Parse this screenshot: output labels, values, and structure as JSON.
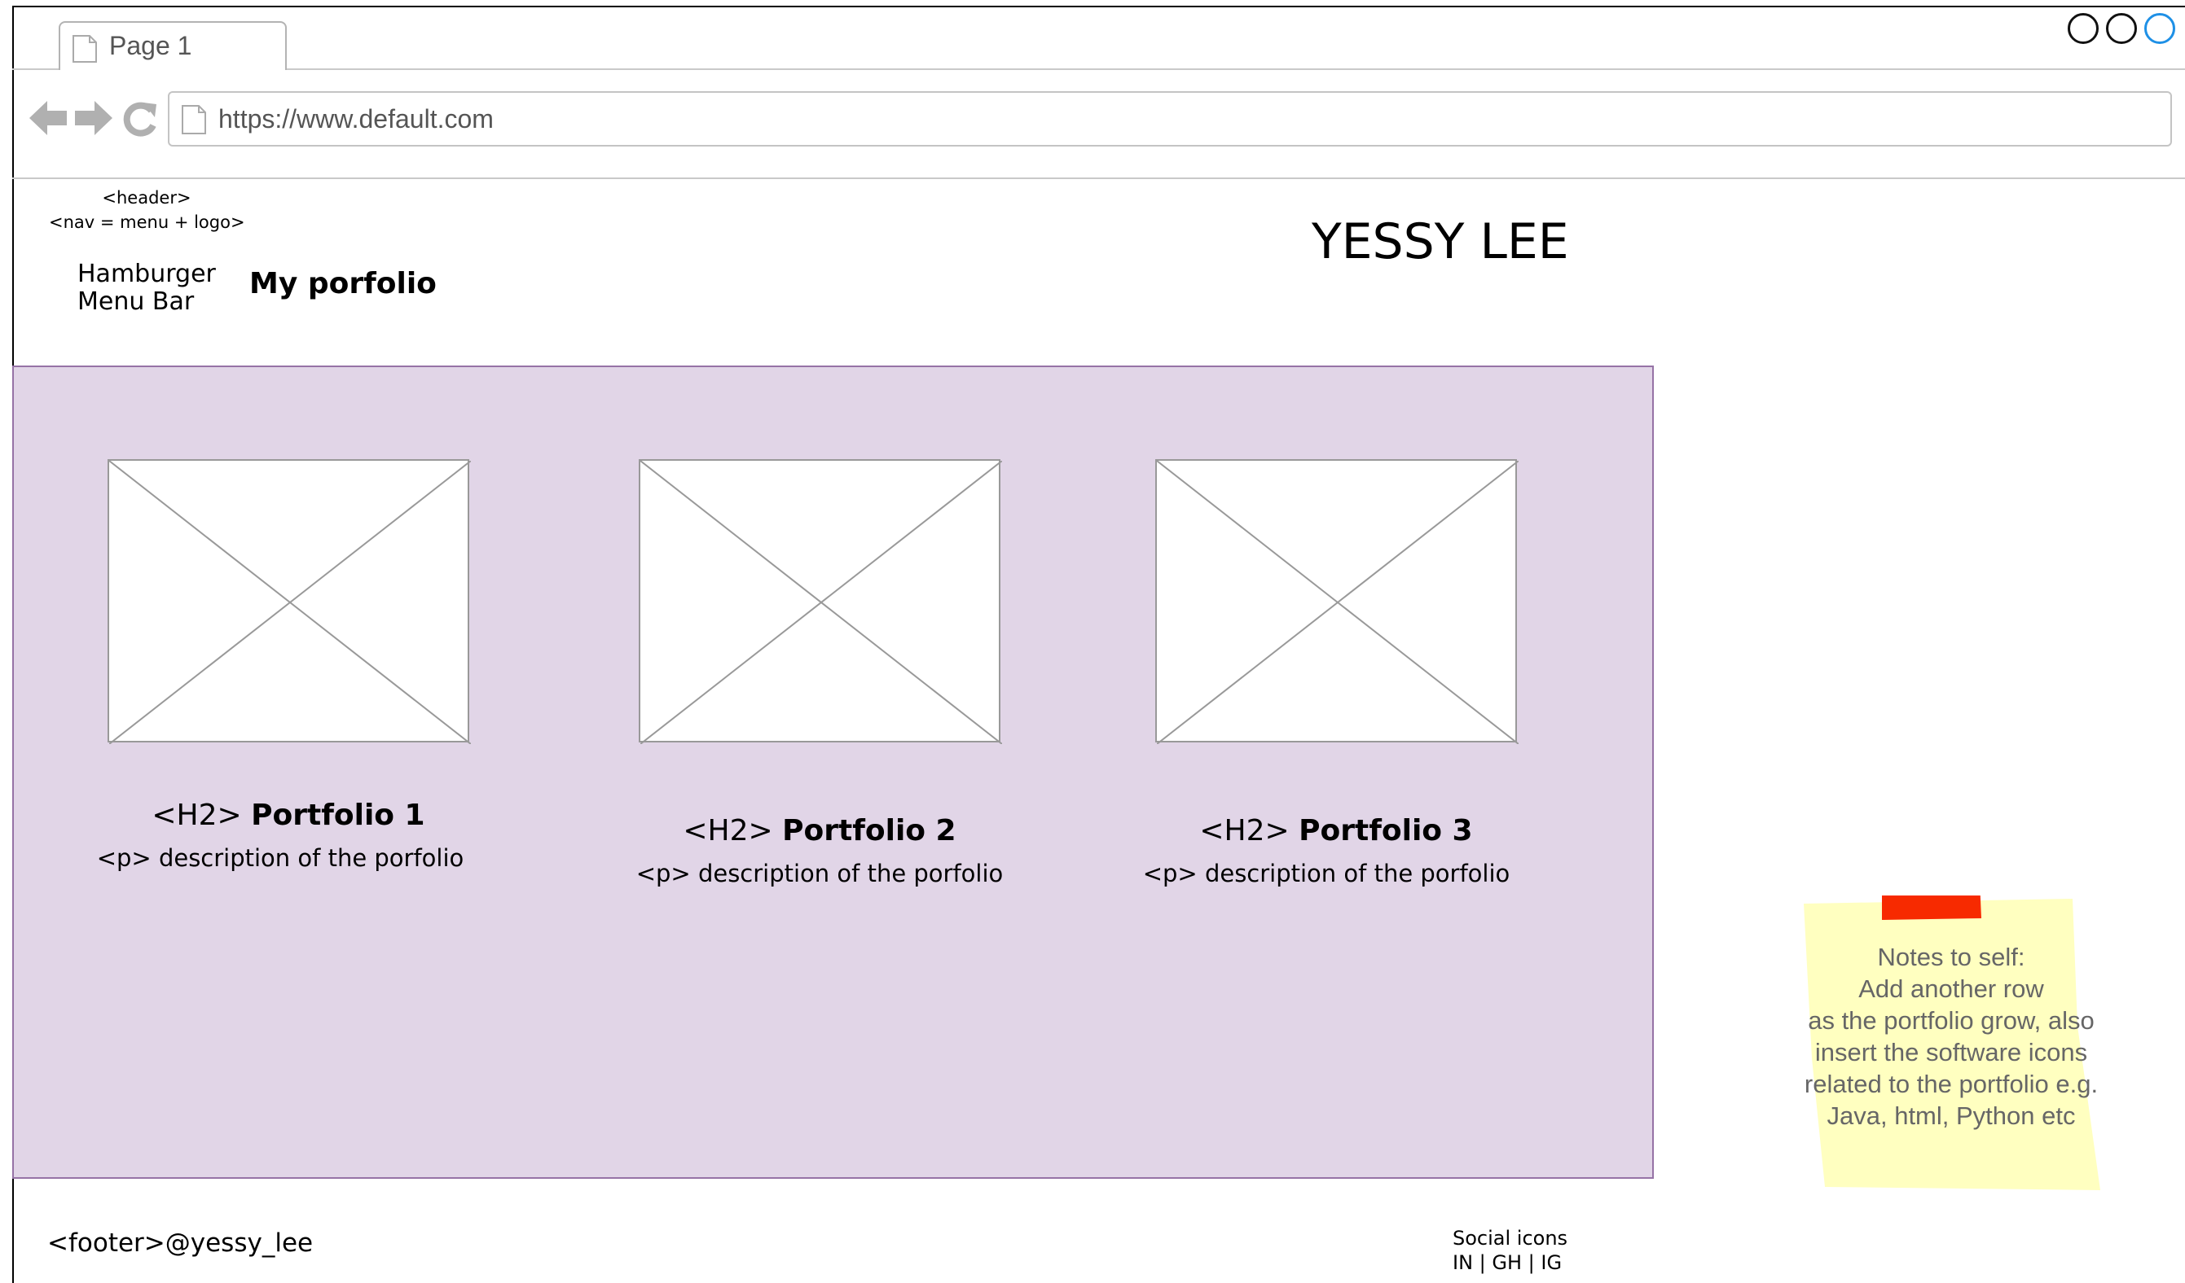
{
  "browser": {
    "tab_label": "Page 1",
    "url": "https://www.default.com",
    "icons": [
      "page-icon",
      "back-arrow-icon",
      "forward-arrow-icon",
      "reload-icon"
    ]
  },
  "header": {
    "note_line1": "<header>",
    "note_line2": "<nav = menu + logo>",
    "hamburger_line1": "Hamburger",
    "hamburger_line2": "Menu Bar",
    "logo": "My porfolio",
    "site_title": "YESSY LEE"
  },
  "portfolios": [
    {
      "tag": "<H2>",
      "title": "Portfolio 1",
      "desc": "<p> description of the porfolio"
    },
    {
      "tag": "<H2>",
      "title": "Portfolio 2",
      "desc": "<p> description of the porfolio"
    },
    {
      "tag": "<H2>",
      "title": "Portfolio 3",
      "desc": "<p> description of the porfolio"
    }
  ],
  "footer": {
    "left": "<footer>@yessy_lee",
    "social_title": "Social icons",
    "social_links": "IN | GH | IG"
  },
  "sticky_note": {
    "lines": [
      "Notes to self:",
      "Add another row",
      "as the portfolio grow, also",
      "insert the software icons",
      "related to the portfolio e.g.",
      "Java, html, Python etc"
    ]
  },
  "colors": {
    "content_bg": "#e1d5e7",
    "content_border": "#9673a6",
    "sticky_bg": "#ffffc0",
    "sticky_tape": "#f72a00",
    "window_control_accent": "#1e90e6"
  }
}
